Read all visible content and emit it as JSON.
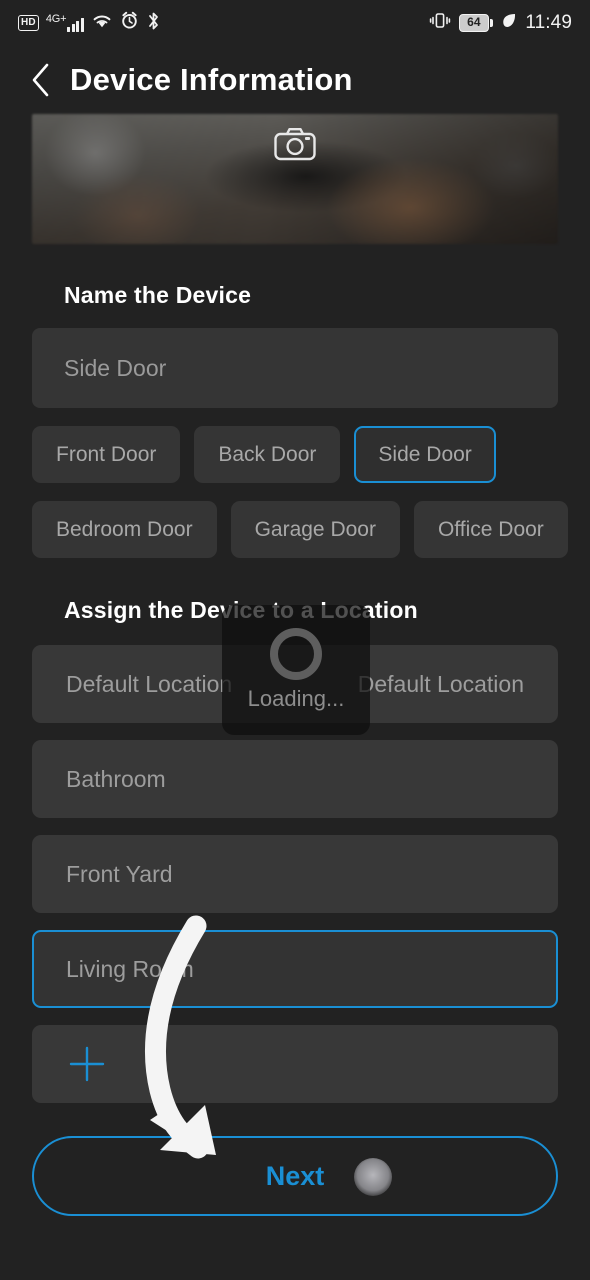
{
  "status_bar": {
    "hd_label": "HD",
    "network_label": "4G+",
    "signal_icon": "signal-bars-icon",
    "wifi_icon": "wifi-icon",
    "alarm_icon": "alarm-clock-icon",
    "bluetooth_icon": "bluetooth-icon",
    "vibrate_icon": "vibrate-icon",
    "battery_level": "64",
    "eco_icon": "leaf-eco-icon",
    "time": "11:49"
  },
  "header": {
    "back_icon": "chevron-left-icon",
    "title": "Device Information"
  },
  "photo_banner": {
    "camera_icon": "camera-icon"
  },
  "name_section": {
    "heading": "Name the Device",
    "input_value": "",
    "input_placeholder": "Side Door",
    "chips_row_1": [
      {
        "label": "Front Door",
        "selected": false
      },
      {
        "label": "Back Door",
        "selected": false
      },
      {
        "label": "Side Door",
        "selected": true
      }
    ],
    "chips_row_2": [
      {
        "label": "Bedroom Door",
        "selected": false
      },
      {
        "label": "Garage Door",
        "selected": false
      },
      {
        "label": "Office Door",
        "selected": false
      }
    ]
  },
  "location_section": {
    "heading": "Assign the Device to a Location",
    "rows": [
      {
        "label": "Default Location",
        "label_right": "Default Location",
        "selected": false
      },
      {
        "label": "Bathroom",
        "label_right": "",
        "selected": false
      },
      {
        "label": "Front Yard",
        "label_right": "",
        "selected": false
      },
      {
        "label": "Living Room",
        "label_right": "",
        "selected": true
      }
    ],
    "add_row": {
      "icon": "plus-icon",
      "label": ""
    }
  },
  "loading_overlay": {
    "spinner_icon": "spinner-ring-icon",
    "text": "Loading..."
  },
  "footer": {
    "next_label": "Next",
    "touch_indicator": "touch-point-indicator"
  },
  "annotation": {
    "arrow_icon": "curved-down-arrow-annotation",
    "color": "#f2f2f2"
  },
  "colors": {
    "background": "#222222",
    "surface": "#353535",
    "accent": "#1a8fd4",
    "text_primary": "#ffffff",
    "text_secondary": "#9a9a9a"
  }
}
